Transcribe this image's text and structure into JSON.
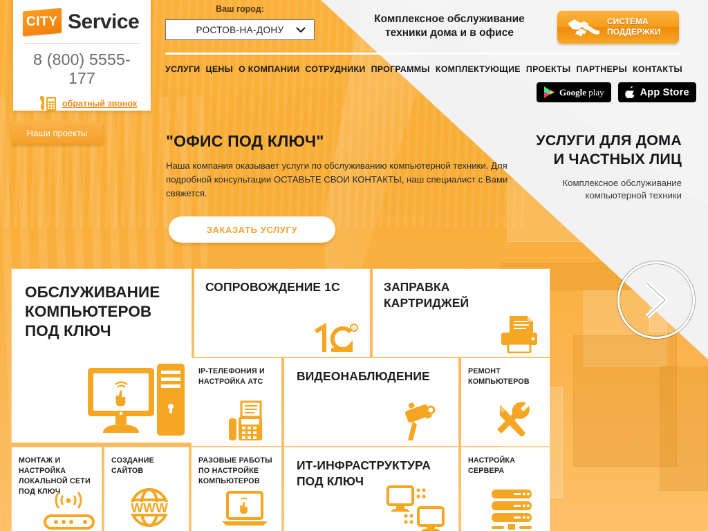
{
  "logo": {
    "badge_text": "CITY",
    "word": "Service",
    "phone": "8 (800) 5555-177",
    "callback_label": "обратный звонок"
  },
  "city": {
    "label": "Ваш город:",
    "selected": "РОСТОВ-НА-ДОНУ",
    "options": [
      "РОСТОВ-НА-ДОНУ"
    ]
  },
  "header": {
    "slogan_line1": "Комплексное обслуживание",
    "slogan_line2": "техники дома и в офисе",
    "support_line1": "СИСТЕМА",
    "support_line2": "ПОДДЕРЖКИ"
  },
  "nav": {
    "items": [
      {
        "label": "УСЛУГИ"
      },
      {
        "label": "ЦЕНЫ"
      },
      {
        "label": "О КОМПАНИИ"
      },
      {
        "label": "СОТРУДНИКИ"
      },
      {
        "label": "ПРОГРАММЫ"
      },
      {
        "label": "КОМПЛЕКТУЮЩИЕ"
      },
      {
        "label": "ПРОЕКТЫ"
      },
      {
        "label": "ПАРТНЕРЫ"
      },
      {
        "label": "КОНТАКТЫ"
      }
    ]
  },
  "stores": {
    "google_play_prefix": "Google",
    "google_play_suffix": "play",
    "app_store": "App Store"
  },
  "projects_tab": {
    "label": "Наши проекты"
  },
  "hero": {
    "title": "\"ОФИС ПОД КЛЮЧ\"",
    "body": "Наша компания оказывает услуги по обслуживанию компьютерной техники. Для подробной консультации ОСТАВЬТЕ СВОИ КОНТАКТЫ, наш специалист с Вами свяжется.",
    "cta_label": "ЗАКАЗАТЬ УСЛУГУ"
  },
  "promo": {
    "title_line1": "УСЛУГИ ДЛЯ ДОМА",
    "title_line2": "И ЧАСТНЫХ ЛИЦ",
    "sub_line1": "Комплексное обслуживание",
    "sub_line2": "компьютерной техники"
  },
  "tiles": {
    "service_pc": {
      "line1": "ОБСЛУЖИВАНИЕ",
      "line2": "КОМПЬЮТЕРОВ",
      "line3": "ПОД КЛЮЧ",
      "icon": "desktop-pc-icon"
    },
    "support_1c": {
      "line1": "СОПРОВОЖДЕНИЕ 1С",
      "icon": "1c-logo-icon"
    },
    "cartridge": {
      "line1": "ЗАПРАВКА",
      "line2": "КАРТРИДЖЕЙ",
      "icon": "printer-icon"
    },
    "ip_phone": {
      "line1": "IP-ТЕЛЕФОНИЯ И",
      "line2": "НАСТРОЙКА АТС",
      "icon": "fax-phone-icon"
    },
    "cctv": {
      "line1": "ВИДЕОНАБЛЮДЕНИЕ",
      "icon": "cctv-camera-icon"
    },
    "pc_repair": {
      "line1": "РЕМОНТ",
      "line2": "КОМПЬЮТЕРОВ",
      "icon": "wrench-screwdriver-icon"
    },
    "lan": {
      "line1": "МОНТАЖ И",
      "line2": "НАСТРОЙКА",
      "line3": "ЛОКАЛЬНОЙ СЕТИ",
      "line4": "ПОД КЛЮЧ",
      "icon": "wifi-router-icon"
    },
    "websites": {
      "line1": "СОЗДАНИЕ",
      "line2": "САЙТОВ",
      "icon": "www-globe-icon"
    },
    "onetime": {
      "line1": "РАЗОВЫЕ РАБОТЫ",
      "line2": "ПО НАСТРОЙКЕ",
      "line3": "КОМПЬЮТЕРОВ",
      "icon": "laptop-icon"
    },
    "it_infra": {
      "line1": "ИТ-ИНФРАСТРУКТУРА",
      "line2": "ПОД КЛЮЧ",
      "icon": "network-monitors-icon"
    },
    "server": {
      "line1": "НАСТРОЙКА",
      "line2": "СЕРВЕРА",
      "icon": "server-rack-icon"
    }
  },
  "colors": {
    "brand_orange": "#f7a929",
    "accent_orange": "#f5a623",
    "icon_orange": "#f5a623",
    "dark_text": "#1e1e1e",
    "white": "#ffffff"
  }
}
